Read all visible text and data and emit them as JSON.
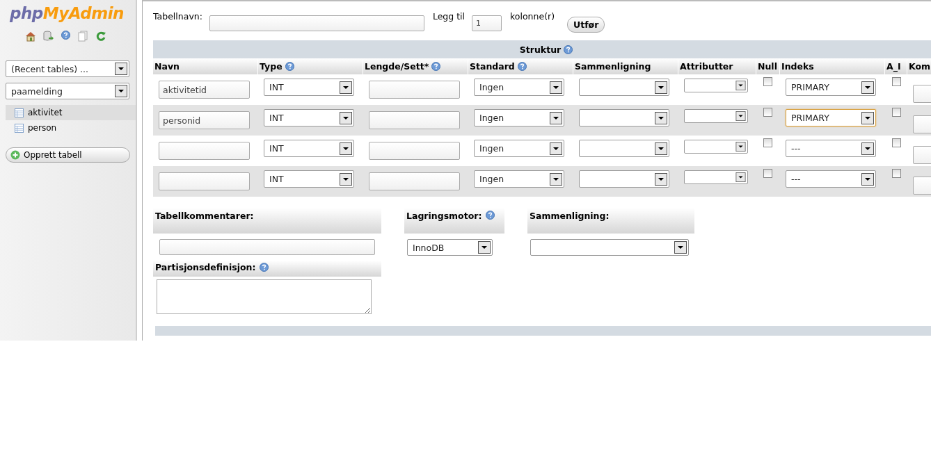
{
  "sidebar": {
    "logo": {
      "php": "php",
      "myadmin": "MyAdmin"
    },
    "recent_tables": "(Recent tables) ...",
    "database": "paamelding",
    "tables": [
      {
        "name": "aktivitet",
        "selected": true
      },
      {
        "name": "person",
        "selected": false
      }
    ],
    "create_table_button": "Opprett tabell"
  },
  "form": {
    "table_name_label": "Tabellnavn:",
    "add_prefix": "Legg til",
    "add_count": "1",
    "add_suffix": "kolonne(r)",
    "go_button": "Utfør"
  },
  "structure": {
    "title": "Struktur",
    "columns": [
      {
        "label": "Navn",
        "help": false
      },
      {
        "label": "Type",
        "help": true
      },
      {
        "label": "Lengde/Sett*",
        "help": true
      },
      {
        "label": "Standard",
        "help": true
      },
      {
        "label": "Sammenligning",
        "help": false
      },
      {
        "label": "Attributter",
        "help": false
      },
      {
        "label": "Null",
        "help": false
      },
      {
        "label": "Indeks",
        "help": false
      },
      {
        "label": "A_I",
        "help": false
      },
      {
        "label": "Kom",
        "help": false
      }
    ],
    "rows": [
      {
        "name": "aktivitetid",
        "type": "INT",
        "default": "Ingen",
        "null": false,
        "index": "PRIMARY",
        "index_focused": false,
        "ai": false
      },
      {
        "name": "personid",
        "type": "INT",
        "default": "Ingen",
        "null": false,
        "index": "PRIMARY",
        "index_focused": true,
        "ai": false
      },
      {
        "type": "INT",
        "default": "Ingen",
        "null": false,
        "index": "---",
        "index_focused": false,
        "ai": false
      },
      {
        "type": "INT",
        "default": "Ingen",
        "null": false,
        "index": "---",
        "index_focused": false,
        "ai": false
      }
    ]
  },
  "options": {
    "comments_label": "Tabellkommentarer:",
    "engine_label": "Lagringsmotor:",
    "engine": "InnoDB",
    "collation_label": "Sammenligning:",
    "partition_label": "Partisjonsdefinisjon:"
  }
}
